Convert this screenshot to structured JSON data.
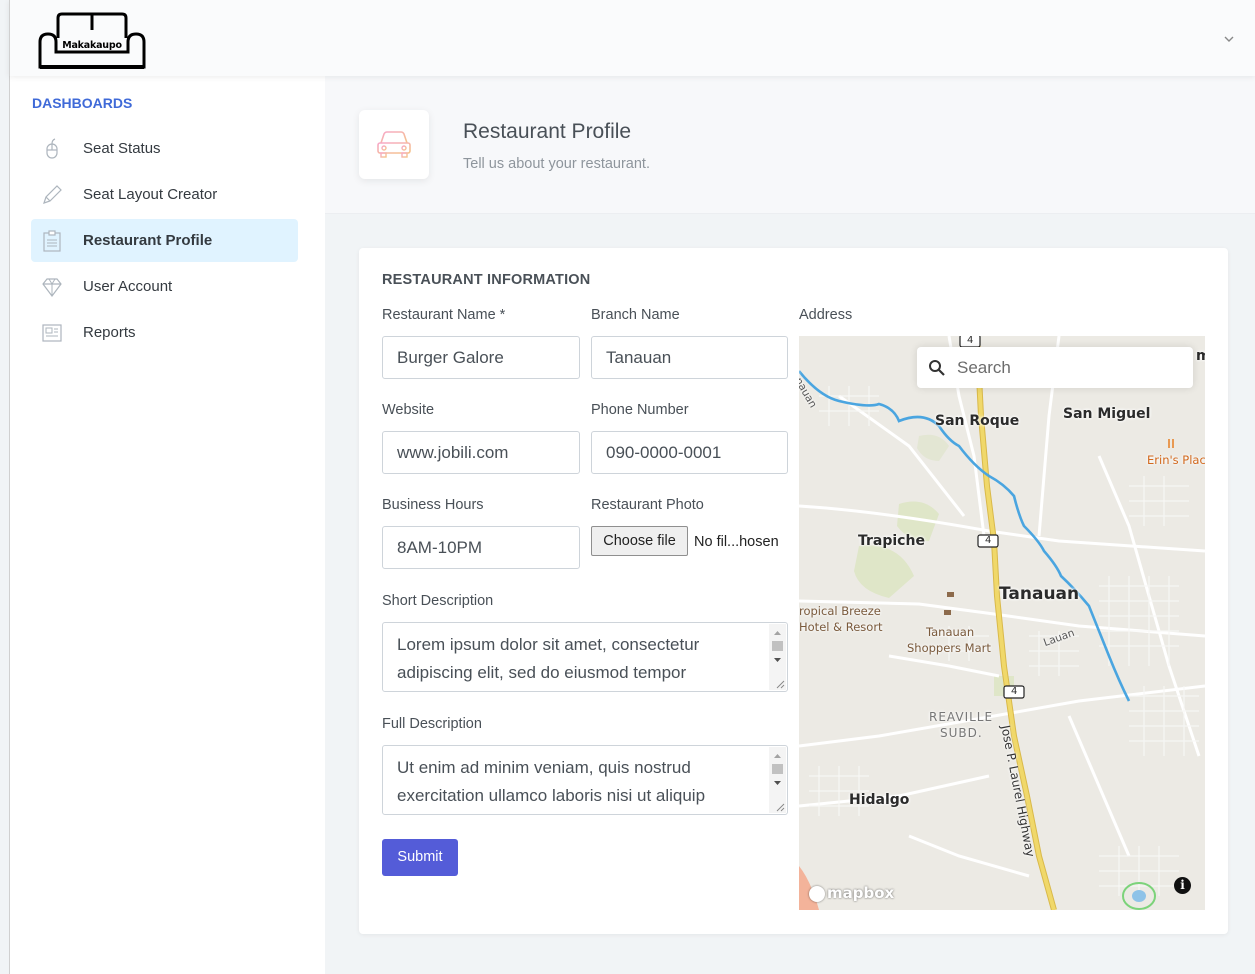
{
  "header": {
    "logo_text": "Makakaupo"
  },
  "sidebar": {
    "heading": "DASHBOARDS",
    "items": [
      {
        "label": "Seat Status",
        "icon": "mouse-icon",
        "active": false
      },
      {
        "label": "Seat Layout Creator",
        "icon": "pencil-icon",
        "active": false
      },
      {
        "label": "Restaurant Profile",
        "icon": "clipboard-icon",
        "active": true
      },
      {
        "label": "User Account",
        "icon": "diamond-icon",
        "active": false
      },
      {
        "label": "Reports",
        "icon": "news-icon",
        "active": false
      }
    ]
  },
  "page": {
    "title": "Restaurant Profile",
    "subtitle": "Tell us about your restaurant.",
    "icon": "car-icon"
  },
  "form": {
    "section_title": "RESTAURANT INFORMATION",
    "restaurant_name": {
      "label": "Restaurant Name *",
      "value": "Burger Galore"
    },
    "branch_name": {
      "label": "Branch Name",
      "value": "Tanauan"
    },
    "website": {
      "label": "Website",
      "value": "www.jobili.com"
    },
    "phone": {
      "label": "Phone Number",
      "value": "090-0000-0001"
    },
    "business_hours": {
      "label": "Business Hours",
      "value": "8AM-10PM"
    },
    "photo": {
      "label": "Restaurant Photo",
      "button": "Choose file",
      "filename": "No fil...hosen"
    },
    "short_description": {
      "label": "Short Description",
      "value": "Lorem ipsum dolor sit amet, consectetur adipiscing elit, sed do eiusmod tempor"
    },
    "full_description": {
      "label": "Full Description",
      "value": "Ut enim ad minim veniam, quis nostrud exercitation ullamco laboris nisi ut aliquip"
    },
    "submit_label": "Submit",
    "address_label": "Address"
  },
  "map": {
    "search_placeholder": "Search",
    "places": {
      "san_roque": "San Roque",
      "san_miguel": "San Miguel",
      "erins_place": "Erin's Place",
      "trapiche": "Trapiche",
      "tanauan": "Tanauan",
      "tropical_1": "ropical Breeze",
      "tropical_2": "Hotel & Resort",
      "mart_1": "Tanauan",
      "mart_2": "Shoppers Mart",
      "lauan": "Lauan",
      "reaville_1": "REAVILLE",
      "reaville_2": "SUBD.",
      "hidalgo": "Hidalgo",
      "highway": "Jose P. Laurel Highway",
      "river_label": "Tanauan",
      "edge_m": "m",
      "route_top": "4",
      "route_mid": "4",
      "route_low": "4"
    },
    "attribution": "mapbox",
    "info": "i"
  },
  "colors": {
    "accent": "#545cd8",
    "sidebar_heading": "#3f6ad8",
    "active_item_bg": "#e0f3ff",
    "river": "#4aa5e0",
    "highway": "#e6c85a"
  }
}
